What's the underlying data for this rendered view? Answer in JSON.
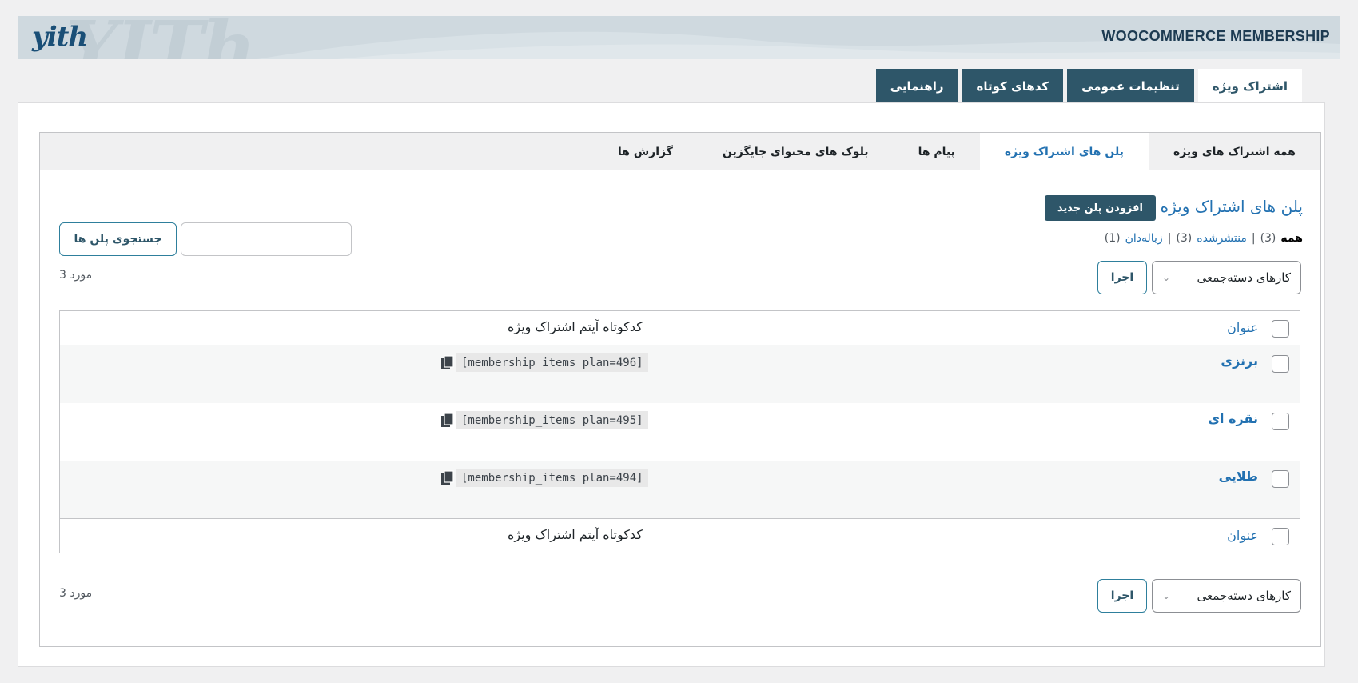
{
  "header": {
    "logo_text": "yith",
    "watermark_text": "YITh",
    "product_title": "WOOCOMMERCE MEMBERSHIP"
  },
  "top_tabs": [
    {
      "label": "اشتراک ویژه",
      "active": true
    },
    {
      "label": "تنظیمات عمومی",
      "active": false
    },
    {
      "label": "کدهای کوتاه",
      "active": false
    },
    {
      "label": "راهنمایی",
      "active": false
    }
  ],
  "sub_tabs": [
    {
      "label": "همه اشتراک های ویژه",
      "active": false
    },
    {
      "label": "پلن های اشتراک ویژه",
      "active": true
    },
    {
      "label": "پیام ها",
      "active": false
    },
    {
      "label": "بلوک های محتوای جایگزین",
      "active": false
    },
    {
      "label": "گزارش ها",
      "active": false
    }
  ],
  "page": {
    "heading": "پلن های اشتراک ویژه",
    "add_new_label": "افزودن پلن جدید"
  },
  "status_filter": {
    "all_label": "همه",
    "all_count": "(3)",
    "published_label": "منتشرشده",
    "published_count": "(3)",
    "trash_label": "زباله‌دان",
    "trash_count": "(1)",
    "separator": "|"
  },
  "search": {
    "value": "",
    "button_label": "جستجوی پلن ها"
  },
  "bulk_actions": {
    "selected": "کارهای دسته‌جمعی",
    "apply_label": "اجرا"
  },
  "items_count": "3 مورد",
  "table": {
    "columns": {
      "title": "عنوان",
      "shortcode": "کدکوتاه آیتم اشتراک ویژه"
    },
    "rows": [
      {
        "title": "برنزی",
        "shortcode": "[membership_items plan=496]"
      },
      {
        "title": "نقره ای",
        "shortcode": "[membership_items plan=495]"
      },
      {
        "title": "طلایی",
        "shortcode": "[membership_items plan=494]"
      }
    ]
  },
  "colors": {
    "accent": "#2e5669",
    "link": "#2271b1",
    "banner": "#cfd9df"
  }
}
